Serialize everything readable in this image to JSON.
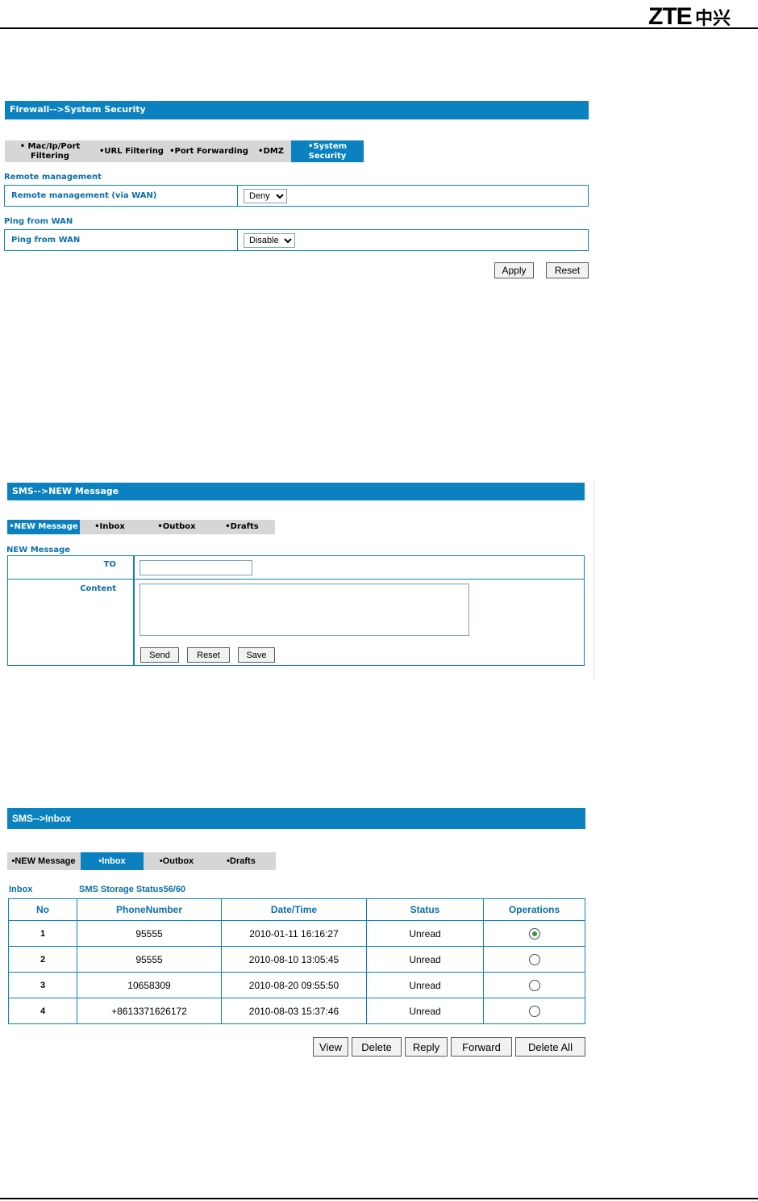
{
  "logo": {
    "text": "ZTE中兴"
  },
  "firewall": {
    "header": "Firewall-->System Security",
    "tabs": [
      {
        "label": "• Mac/Ip/Port Filtering"
      },
      {
        "label": "•URL Filtering"
      },
      {
        "label": "•Port Forwarding"
      },
      {
        "label": "•DMZ"
      },
      {
        "label": "•System Security"
      }
    ],
    "remote_section": "Remote management",
    "remote_label": "Remote management (via WAN)",
    "remote_value": "Deny",
    "ping_section": "Ping from WAN",
    "ping_label": "Ping from WAN",
    "ping_value": "Disable",
    "apply": "Apply",
    "reset": "Reset"
  },
  "newmsg": {
    "header": "SMS-->NEW Message",
    "tabs": [
      {
        "label": "•NEW Message"
      },
      {
        "label": "•Inbox"
      },
      {
        "label": "•Outbox"
      },
      {
        "label": "•Drafts"
      }
    ],
    "section": "NEW Message",
    "to_label": "TO",
    "content_label": "Content",
    "send": "Send",
    "reset": "Reset",
    "save": "Save"
  },
  "inbox": {
    "header": "SMS-->Inbox",
    "tabs": [
      {
        "label": "•NEW Message"
      },
      {
        "label": "•Inbox"
      },
      {
        "label": "•Outbox"
      },
      {
        "label": "•Drafts"
      }
    ],
    "section": "Inbox",
    "storage": "SMS Storage Status56/60",
    "columns": [
      "No",
      "PhoneNumber",
      "Date/Time",
      "Status",
      "Operations"
    ],
    "rows": [
      {
        "no": "1",
        "phone": "95555",
        "datetime": "2010-01-11 16:16:27",
        "status": "Unread",
        "selected": true
      },
      {
        "no": "2",
        "phone": "95555",
        "datetime": "2010-08-10 13:05:45",
        "status": "Unread",
        "selected": false
      },
      {
        "no": "3",
        "phone": "10658309",
        "datetime": "2010-08-20 09:55:50",
        "status": "Unread",
        "selected": false
      },
      {
        "no": "4",
        "phone": "+8613371626172",
        "datetime": "2010-08-03 15:37:46",
        "status": "Unread",
        "selected": false
      }
    ],
    "buttons": {
      "view": "View",
      "delete": "Delete",
      "reply": "Reply",
      "forward": "Forward",
      "delete_all": "Delete All"
    }
  },
  "colors": {
    "accent": "#0b82bf",
    "tab_bg": "#d6d6d6",
    "label": "#0b6ea8",
    "radio_dot": "#2c9b37"
  }
}
